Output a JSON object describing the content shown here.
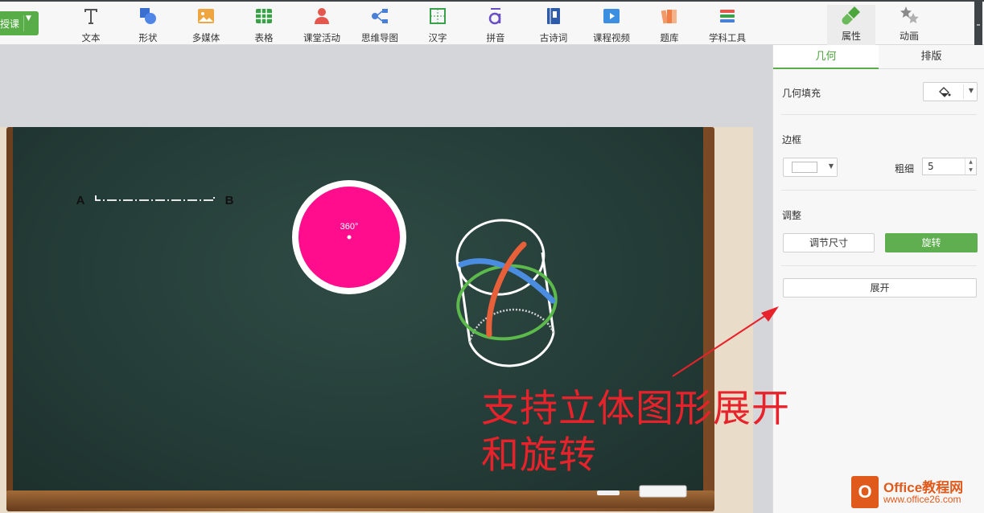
{
  "toolbar": {
    "teach_label": "授课",
    "tools": [
      {
        "label": "文本",
        "icon": "text-icon"
      },
      {
        "label": "形状",
        "icon": "shape-icon"
      },
      {
        "label": "多媒体",
        "icon": "media-icon"
      },
      {
        "label": "表格",
        "icon": "table-icon"
      },
      {
        "label": "课堂活动",
        "icon": "class-activity-icon"
      },
      {
        "label": "思维导图",
        "icon": "mind-map-icon"
      },
      {
        "label": "汉字",
        "icon": "chinese-character-icon"
      },
      {
        "label": "拼音",
        "icon": "pinyin-icon"
      },
      {
        "label": "古诗词",
        "icon": "poetry-icon"
      },
      {
        "label": "课程视频",
        "icon": "course-video-icon"
      },
      {
        "label": "题库",
        "icon": "question-bank-icon"
      },
      {
        "label": "学科工具",
        "icon": "subject-tools-icon"
      }
    ],
    "right_tabs": [
      {
        "label": "属性",
        "icon": "brush-icon"
      },
      {
        "label": "动画",
        "icon": "stars-icon"
      }
    ]
  },
  "board": {
    "point_a": "A",
    "point_b": "B",
    "angle_label": "360°"
  },
  "panel": {
    "tabs": [
      "几何",
      "排版"
    ],
    "fill_label": "几何填充",
    "border_label": "边框",
    "stroke_width_label": "粗细",
    "stroke_width_value": "5",
    "adjust_label": "调整",
    "resize_button": "调节尺寸",
    "rotate_button": "旋转",
    "expand_button": "展开"
  },
  "annotation": {
    "line1": "支持立体图形展开",
    "line2": "和旋转"
  },
  "watermark": {
    "logo_letter": "O",
    "title": "Office教程网",
    "url": "www.office26.com"
  },
  "colors": {
    "accent_green": "#58ad48",
    "annotation_red": "#e8222b",
    "circle_pink": "#ff0d8c",
    "board_green": "#243c37"
  }
}
